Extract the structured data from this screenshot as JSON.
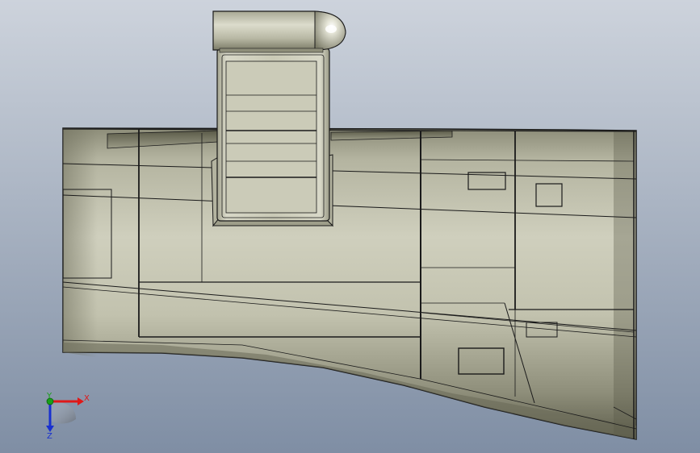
{
  "viewport": {
    "background_top": "#cdd3dc",
    "background_bottom": "#7f8ea4",
    "model_color": "#c4c4b0",
    "model_shadow": "#7a7a66",
    "edge_color": "#1a1a1a"
  },
  "triad": {
    "x_label": "X",
    "y_label": "Y",
    "z_label": "Z",
    "x_color": "#e01818",
    "y_color": "#18a018",
    "z_color": "#1830d0"
  }
}
